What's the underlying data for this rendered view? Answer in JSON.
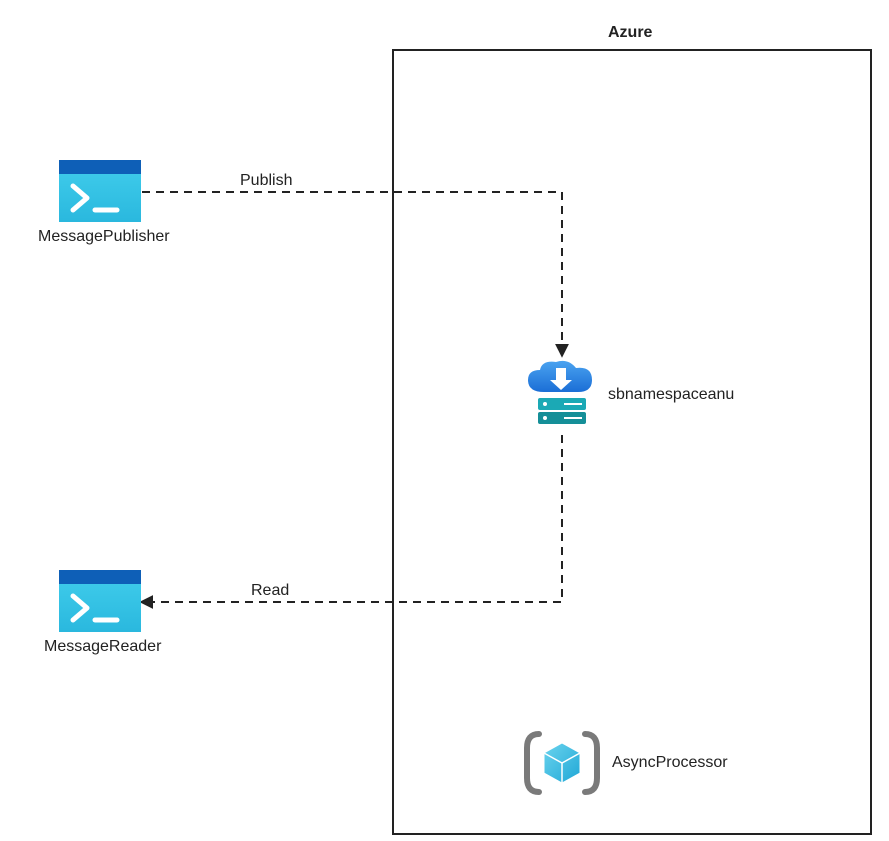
{
  "container": {
    "title": "Azure"
  },
  "nodes": {
    "publisher": {
      "label": "MessagePublisher"
    },
    "reader": {
      "label": "MessageReader"
    },
    "servicebus": {
      "label": "sbnamespaceanu"
    },
    "processor": {
      "label": "AsyncProcessor"
    }
  },
  "edges": {
    "publish": {
      "label": "Publish"
    },
    "read": {
      "label": "Read"
    }
  },
  "colors": {
    "azure_blue": "#0078D4",
    "accent_cyan": "#32C8E8",
    "accent_cyan_light": "#5AD1EC",
    "teal": "#1BA9B5",
    "teal_dark": "#158F98"
  }
}
